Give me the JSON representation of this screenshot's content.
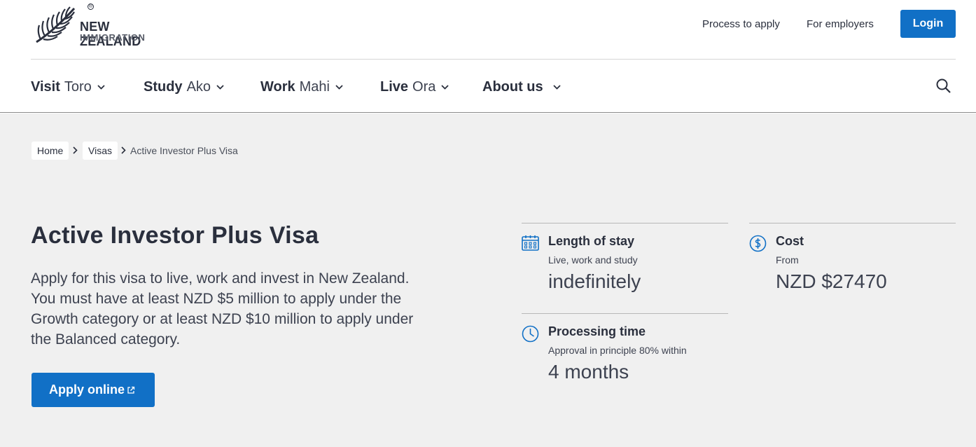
{
  "brand": {
    "line1": "NEW ZEALAND",
    "line2": "IMMIGRATION",
    "mark": "fern-logo-icon",
    "tm": "®"
  },
  "toplinks": {
    "process": "Process to apply",
    "employers": "For employers",
    "login": "Login"
  },
  "nav": {
    "items": [
      {
        "en": "Visit",
        "mi": "Toro"
      },
      {
        "en": "Study",
        "mi": "Ako"
      },
      {
        "en": "Work",
        "mi": "Mahi"
      },
      {
        "en": "Live",
        "mi": "Ora"
      },
      {
        "en": "About us",
        "mi": ""
      }
    ],
    "search_icon": "search-icon"
  },
  "breadcrumb": {
    "home": "Home",
    "visas": "Visas",
    "current": "Active Investor Plus Visa"
  },
  "page": {
    "title": "Active Investor Plus Visa",
    "description": "Apply for this visa to live, work and invest in New Zealand. You must have at least NZD $5 million to apply under the Growth category or at least NZD $10 million to apply under the Balanced category.",
    "apply_label": "Apply online"
  },
  "info": {
    "stay": {
      "icon": "calendar-icon",
      "label": "Length of stay",
      "sub": "Live, work and study",
      "value": "indefinitely"
    },
    "processing": {
      "icon": "clock-icon",
      "label": "Processing time",
      "sub": "Approval in principle 80% within",
      "value": "4 months"
    },
    "cost": {
      "icon": "dollar-icon",
      "label": "Cost",
      "sub": "From",
      "value": "NZD $27470"
    }
  },
  "colors": {
    "accent": "#1170c6",
    "text": "#2a2f3d",
    "background": "#f0f0f0"
  }
}
